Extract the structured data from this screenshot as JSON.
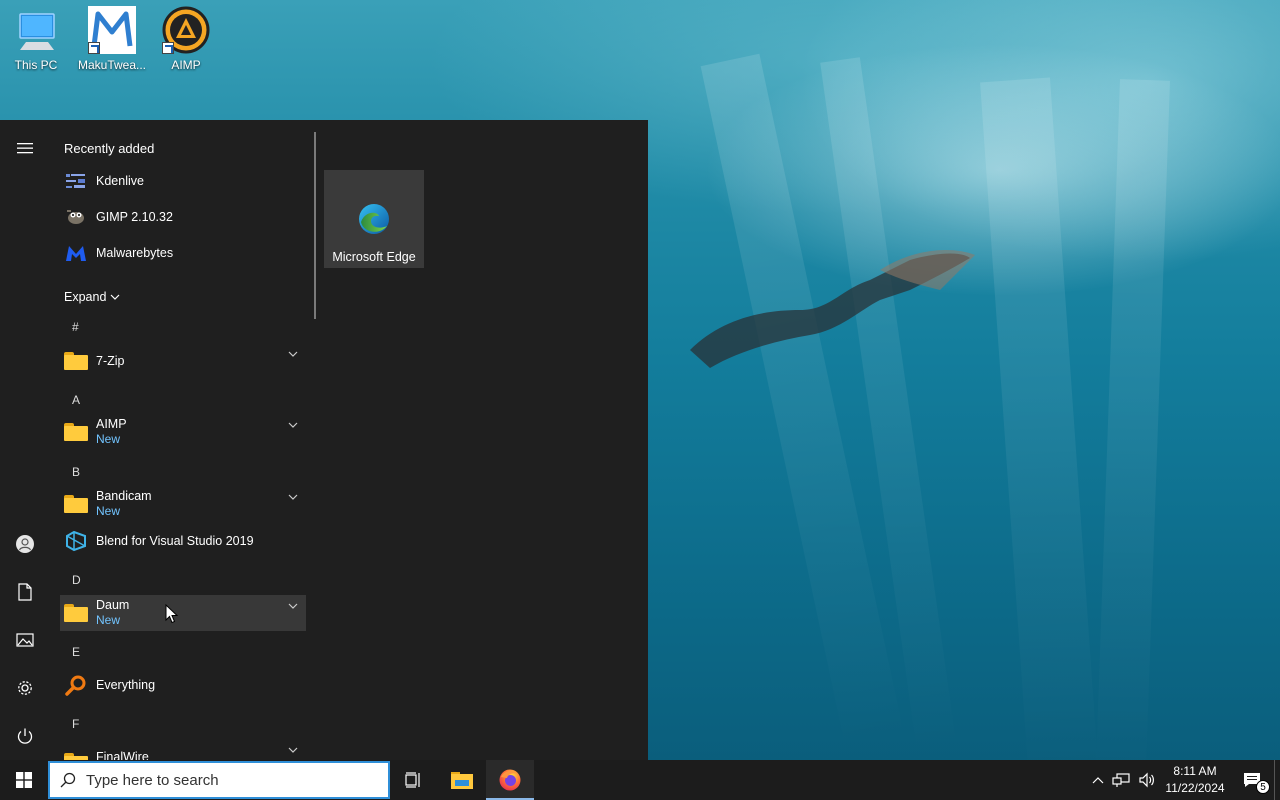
{
  "desktop": {
    "icons": [
      {
        "label": "This PC",
        "icon": "this-pc-icon"
      },
      {
        "label": "MakuTwea...",
        "icon": "makutweaker-icon"
      },
      {
        "label": "AIMP",
        "icon": "aimp-icon"
      }
    ]
  },
  "start_menu": {
    "recently_added_title": "Recently added",
    "recent_apps": [
      {
        "name": "Kdenlive",
        "icon": "kdenlive-icon"
      },
      {
        "name": "GIMP 2.10.32",
        "icon": "gimp-icon"
      },
      {
        "name": "Malwarebytes",
        "icon": "malwarebytes-icon"
      }
    ],
    "expand_label": "Expand",
    "letters": [
      "#",
      "A",
      "B",
      "D",
      "E",
      "F"
    ],
    "apps": [
      {
        "name": "7-Zip",
        "new": "",
        "icon": "folder-icon"
      },
      {
        "name": "AIMP",
        "new": "New",
        "icon": "folder-icon"
      },
      {
        "name": "Bandicam",
        "new": "New",
        "icon": "folder-icon"
      },
      {
        "name": "Blend for Visual Studio 2019",
        "new": "",
        "icon": "blend-icon"
      },
      {
        "name": "Daum",
        "new": "New",
        "icon": "folder-icon"
      },
      {
        "name": "Everything",
        "new": "",
        "icon": "everything-icon"
      },
      {
        "name": "FinalWire",
        "new": "",
        "icon": "folder-icon"
      }
    ],
    "tiles": [
      {
        "label": "Microsoft Edge",
        "icon": "edge-icon"
      }
    ]
  },
  "taskbar": {
    "search_placeholder": "Type here to search",
    "time": "8:11 AM",
    "date": "11/22/2024",
    "notification_count": "5"
  },
  "colors": {
    "start_bg": "#1f1f1f",
    "accent_new": "#72c4ff",
    "search_border": "#2f8fd8"
  }
}
